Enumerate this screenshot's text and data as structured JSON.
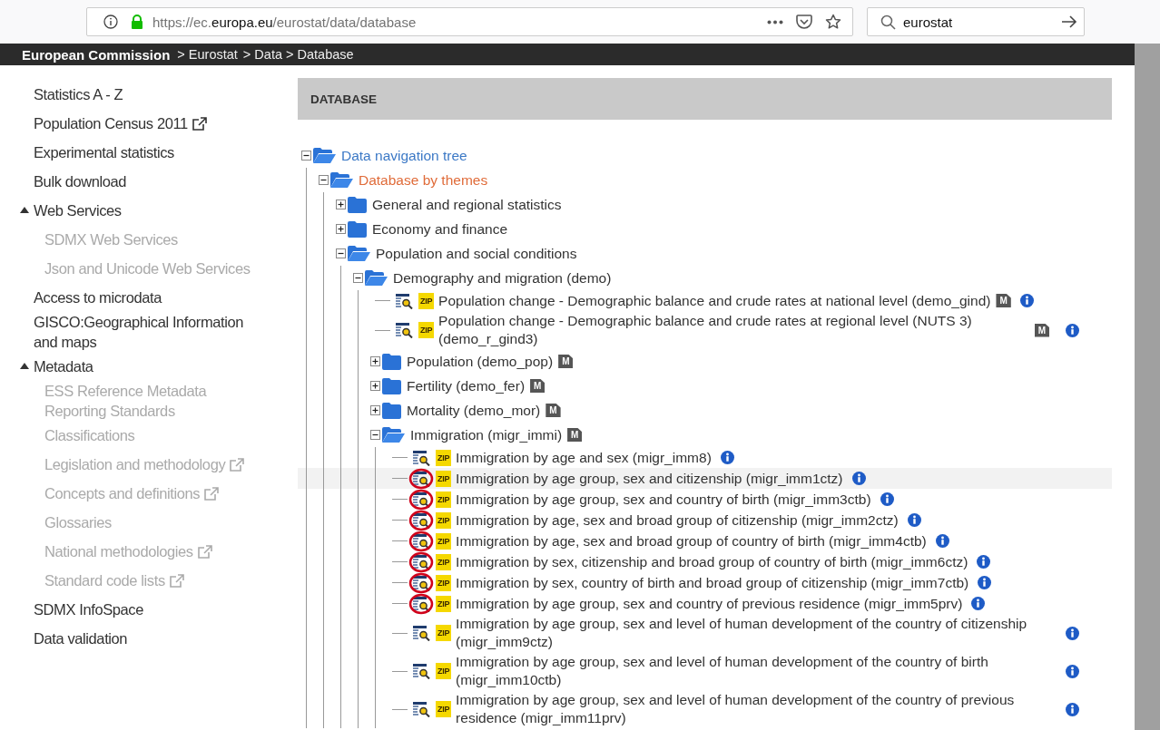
{
  "browser": {
    "url": {
      "prefix": "https://ec.",
      "domain": "europa.eu",
      "path": "/eurostat/data/database"
    },
    "search": {
      "value": "eurostat"
    }
  },
  "breadcrumb": [
    {
      "label": "European Commission",
      "kind": "home"
    },
    {
      "label": "> Eurostat",
      "kind": "link"
    },
    {
      "label": "> Data > Database",
      "kind": "link"
    }
  ],
  "sidebar": {
    "items": [
      {
        "label": "Statistics A - Z",
        "external": false
      },
      {
        "label": "Population Census 2011",
        "external": true
      },
      {
        "label": "Experimental statistics",
        "external": false
      },
      {
        "label": "Bulk download",
        "external": false
      },
      {
        "label": "Web Services",
        "external": false,
        "expanded": true,
        "children": [
          {
            "label": "SDMX Web Services",
            "external": false
          },
          {
            "label": "Json and Unicode Web Services",
            "external": false
          }
        ]
      },
      {
        "label": "Access to microdata",
        "external": false
      },
      {
        "label": "GISCO:Geographical Information and maps",
        "external": false
      },
      {
        "label": "Metadata",
        "external": false,
        "expanded": true,
        "children": [
          {
            "label": "ESS Reference Metadata Reporting Standards",
            "external": false
          },
          {
            "label": "Classifications",
            "external": false
          },
          {
            "label": "Legislation and methodology",
            "external": true
          },
          {
            "label": "Concepts and definitions",
            "external": true
          },
          {
            "label": "Glossaries",
            "external": false
          },
          {
            "label": "National methodologies",
            "external": true
          },
          {
            "label": "Standard code lists",
            "external": true
          }
        ]
      },
      {
        "label": "SDMX InfoSpace",
        "external": false
      },
      {
        "label": "Data validation",
        "external": false
      }
    ]
  },
  "main": {
    "heading": "DATABASE",
    "tree": [
      {
        "kind": "folder",
        "label": "Data navigation tree",
        "expanded": true,
        "selected": false,
        "children": [
          {
            "kind": "folder",
            "label": "Database by themes",
            "expanded": true,
            "selected": true,
            "children": [
              {
                "kind": "folder",
                "label": "General and regional statistics",
                "expanded": false,
                "selected": false
              },
              {
                "kind": "folder",
                "label": "Economy and finance",
                "expanded": false,
                "selected": false
              },
              {
                "kind": "folder",
                "label": "Population and social conditions",
                "expanded": true,
                "selected": false,
                "children": [
                  {
                    "kind": "folder",
                    "label": "Demography and migration (demo)",
                    "expanded": true,
                    "selected": false,
                    "children": [
                      {
                        "kind": "dataset",
                        "label": "Population change - Demographic balance and crude rates at national level (demo_gind)",
                        "zip": "ZIP",
                        "metadata": "M",
                        "info": true,
                        "circled": false,
                        "hovered": false
                      },
                      {
                        "kind": "dataset",
                        "label": "Population change - Demographic balance and crude rates at regional level (NUTS 3) (demo_r_gind3)",
                        "zip": "ZIP",
                        "metadata": "M",
                        "info": true,
                        "circled": false,
                        "hovered": false
                      },
                      {
                        "kind": "folder",
                        "label": "Population (demo_pop)",
                        "expanded": false,
                        "selected": false,
                        "metadata": "M"
                      },
                      {
                        "kind": "folder",
                        "label": "Fertility (demo_fer)",
                        "expanded": false,
                        "selected": false,
                        "metadata": "M"
                      },
                      {
                        "kind": "folder",
                        "label": "Mortality (demo_mor)",
                        "expanded": false,
                        "selected": false,
                        "metadata": "M"
                      },
                      {
                        "kind": "folder",
                        "label": "Immigration (migr_immi)",
                        "expanded": true,
                        "selected": false,
                        "metadata": "M",
                        "children": [
                          {
                            "kind": "dataset",
                            "label": "Immigration by age and sex (migr_imm8)",
                            "zip": "ZIP",
                            "info": true,
                            "circled": false,
                            "hovered": false
                          },
                          {
                            "kind": "dataset",
                            "label": "Immigration by age group, sex and citizenship (migr_imm1ctz)",
                            "zip": "ZIP",
                            "info": true,
                            "circled": true,
                            "hovered": true
                          },
                          {
                            "kind": "dataset",
                            "label": "Immigration by age group, sex and country of birth (migr_imm3ctb)",
                            "zip": "ZIP",
                            "info": true,
                            "circled": true,
                            "hovered": false
                          },
                          {
                            "kind": "dataset",
                            "label": "Immigration by age, sex and broad group of citizenship (migr_imm2ctz)",
                            "zip": "ZIP",
                            "info": true,
                            "circled": true,
                            "hovered": false
                          },
                          {
                            "kind": "dataset",
                            "label": "Immigration by age, sex and broad group of country of birth (migr_imm4ctb)",
                            "zip": "ZIP",
                            "info": true,
                            "circled": true,
                            "hovered": false
                          },
                          {
                            "kind": "dataset",
                            "label": "Immigration by sex, citizenship and broad group of country of birth (migr_imm6ctz)",
                            "zip": "ZIP",
                            "info": true,
                            "circled": true,
                            "hovered": false
                          },
                          {
                            "kind": "dataset",
                            "label": "Immigration by sex, country of birth and broad group of citizenship (migr_imm7ctb)",
                            "zip": "ZIP",
                            "info": true,
                            "circled": true,
                            "hovered": false
                          },
                          {
                            "kind": "dataset",
                            "label": "Immigration by age group, sex and country of previous residence (migr_imm5prv)",
                            "zip": "ZIP",
                            "info": true,
                            "circled": true,
                            "hovered": false
                          },
                          {
                            "kind": "dataset",
                            "label": "Immigration by age group, sex and level of human development of the country of citizenship (migr_imm9ctz)",
                            "zip": "ZIP",
                            "info": true,
                            "circled": false,
                            "hovered": false
                          },
                          {
                            "kind": "dataset",
                            "label": "Immigration by age group, sex and level of human development of the country of birth (migr_imm10ctb)",
                            "zip": "ZIP",
                            "info": true,
                            "circled": false,
                            "hovered": false
                          },
                          {
                            "kind": "dataset",
                            "label": "Immigration by age group, sex and level of human development of the country of previous residence (migr_imm11prv)",
                            "zip": "ZIP",
                            "info": true,
                            "circled": false,
                            "hovered": false
                          }
                        ]
                      }
                    ]
                  }
                ]
              }
            ]
          }
        ]
      }
    ]
  }
}
